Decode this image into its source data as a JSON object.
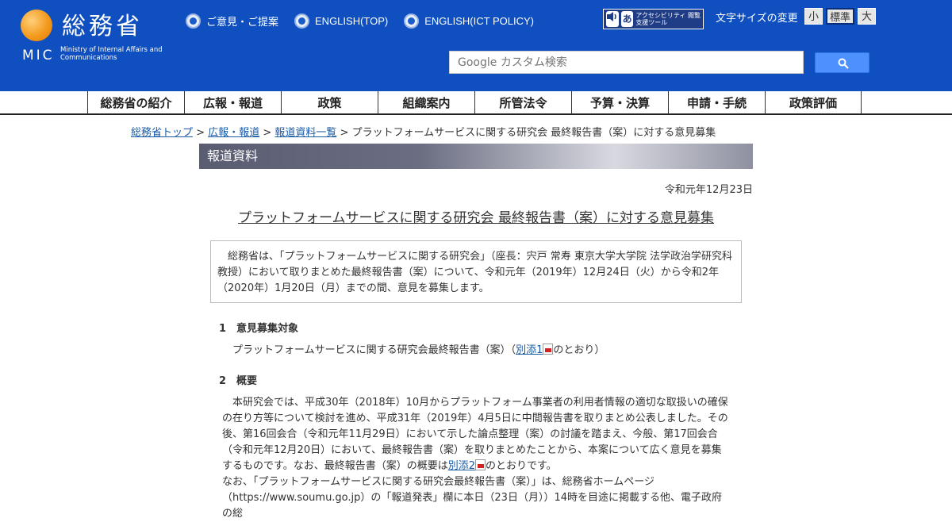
{
  "header": {
    "logo": {
      "title": "総務省",
      "abbr": "MIC",
      "english": "Ministry of Internal Affairs and Communications"
    },
    "top_links": [
      {
        "label": "ご意見・ご提案"
      },
      {
        "label": "ENGLISH(TOP)"
      },
      {
        "label": "ENGLISH(ICT POLICY)"
      }
    ],
    "access_tool": {
      "text": "アクセシビリティ 閲覧支援ツール",
      "icon_glyph": "あ"
    },
    "font_size": {
      "label": "文字サイズの変更",
      "small": "小",
      "standard": "標準",
      "large": "大"
    },
    "search": {
      "placeholder": "Google カスタム検索"
    }
  },
  "nav": {
    "items": [
      {
        "label": "総務省の紹介"
      },
      {
        "label": "広報・報道"
      },
      {
        "label": "政策"
      },
      {
        "label": "組織案内"
      },
      {
        "label": "所管法令"
      },
      {
        "label": "予算・決算"
      },
      {
        "label": "申請・手続"
      },
      {
        "label": "政策評価"
      }
    ]
  },
  "breadcrumb": {
    "links": [
      "総務省トップ",
      "広報・報道",
      "報道資料一覧"
    ],
    "separator": " > ",
    "current": "プラットフォームサービスに関する研究会 最終報告書（案）に対する意見募集"
  },
  "section": {
    "title": "報道資料"
  },
  "article": {
    "date": "令和元年12月23日",
    "title": "プラットフォームサービスに関する研究会 最終報告書（案）に対する意見募集",
    "summary": "総務省は、「プラットフォームサービスに関する研究会」（座長：宍戸 常寿 東京大学大学院 法学政治学研究科 教授）において取りまとめた最終報告書（案）について、令和元年（2019年）12月24日（火）から令和2年（2020年）1月20日（月）までの間、意見を募集します。",
    "section1": {
      "heading": "1　意見募集対象",
      "text_before": "プラットフォームサービスに関する研究会最終報告書（案）（",
      "link": "別添1",
      "text_after": "のとおり）"
    },
    "section2": {
      "heading": "2　概要",
      "text_before": "本研究会では、平成30年（2018年）10月からプラットフォーム事業者の利用者情報の適切な取扱いの確保の在り方等について検討を進め、平成31年（2019年）4月5日に中間報告書を取りまとめ公表しました。その後、第16回会合（令和元年11月29日）において示した論点整理（案）の討議を踏まえ、今般、第17回会合（令和元年12月20日）において、最終報告書（案）を取りまとめたことから、本案について広く意見を募集するものです。なお、最終報告書（案）の概要は",
      "link": "別添2",
      "text_after": "のとおりです。",
      "text_continued": "なお、「プラットフォームサービスに関する研究会最終報告書（案）」は、総務省ホームページ（https://www.soumu.go.jp）の「報道発表」欄に本日（23日（月））14時を目途に掲載する他、電子政府の総"
    }
  },
  "colors": {
    "header_bg": "#0f4fbf",
    "link": "#1a5ba6",
    "search_button": "#4d90fe",
    "logo_orange": "#f39a1e"
  }
}
